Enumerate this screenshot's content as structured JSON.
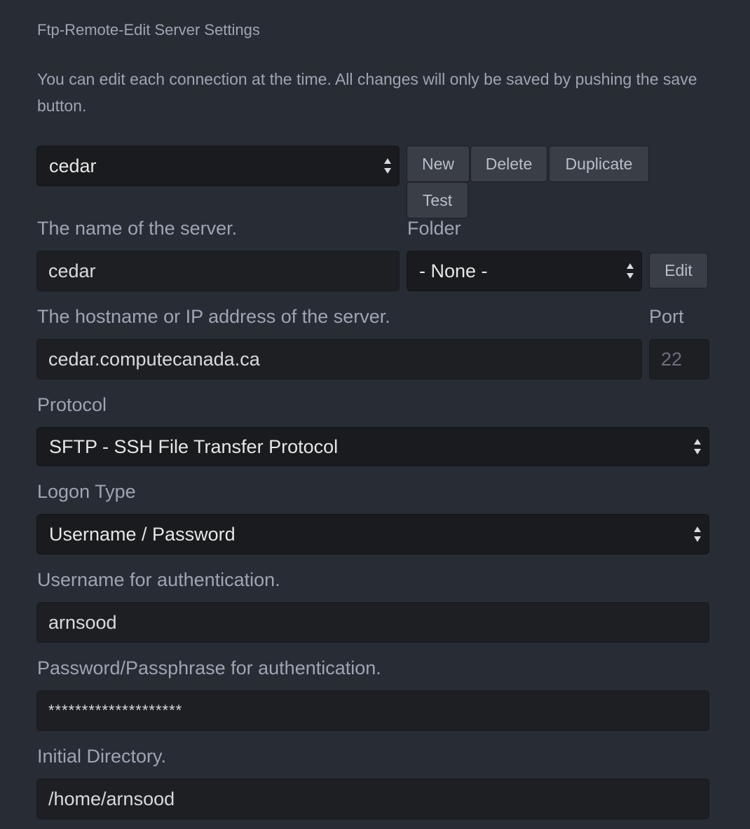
{
  "header": {
    "title": "Ftp-Remote-Edit Server Settings",
    "description": "You can edit each connection at the time. All changes will only be saved by pushing the save button."
  },
  "server_select": {
    "selected": "cedar"
  },
  "actions": {
    "new": "New",
    "delete": "Delete",
    "duplicate": "Duplicate",
    "test": "Test"
  },
  "form": {
    "name": {
      "label": "The name of the server.",
      "value": "cedar"
    },
    "folder": {
      "label": "Folder",
      "selected": "- None -",
      "edit_label": "Edit"
    },
    "host": {
      "label": "The hostname or IP address of the server.",
      "value": "cedar.computecanada.ca"
    },
    "port": {
      "label": "Port",
      "value": "22"
    },
    "protocol": {
      "label": "Protocol",
      "selected": "SFTP - SSH File Transfer Protocol"
    },
    "logon_type": {
      "label": "Logon Type",
      "selected": "Username / Password"
    },
    "username": {
      "label": "Username for authentication.",
      "value": "arnsood"
    },
    "password": {
      "label": "Password/Passphrase for authentication.",
      "value": "********************"
    },
    "initial_directory": {
      "label": "Initial Directory.",
      "value": "/home/arnsood"
    }
  },
  "icons": {
    "select_arrows": "updown-arrows-icon"
  },
  "colors": {
    "background": "#282c34",
    "input_bg": "#1d1f23",
    "select_bg": "#1a1b1e",
    "button_bg": "#393e47",
    "text": "#9da5b4",
    "input_text": "#d7dae0"
  }
}
